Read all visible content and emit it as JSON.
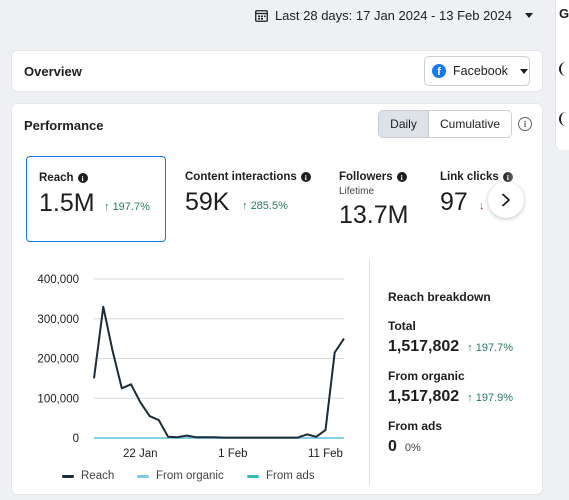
{
  "date_range": {
    "label": "Last 28 days: 17 Jan 2024 - 13 Feb 2024",
    "icon": "calendar-icon"
  },
  "right_panel": {
    "glyph": "G"
  },
  "overview": {
    "title": "Overview",
    "platform_select": "Facebook",
    "platform_color": "#1877f2"
  },
  "performance": {
    "title": "Performance",
    "view_toggle": [
      "Daily",
      "Cumulative"
    ],
    "selected_view": "Daily",
    "metrics": [
      {
        "label": "Reach",
        "value": "1.5M",
        "change": "197.7%",
        "selected": true
      },
      {
        "label": "Content interactions",
        "value": "59K",
        "change": "285.5%"
      },
      {
        "label": "Followers",
        "sublabel": "Lifetime",
        "value": "13.7M"
      },
      {
        "label": "Link clicks",
        "value": "97"
      }
    ]
  },
  "chart_data": {
    "type": "line",
    "x": [
      "17 Jan",
      "18 Jan",
      "19 Jan",
      "20 Jan",
      "21 Jan",
      "22 Jan",
      "23 Jan",
      "24 Jan",
      "25 Jan",
      "26 Jan",
      "27 Jan",
      "28 Jan",
      "29 Jan",
      "30 Jan",
      "31 Jan",
      "1 Feb",
      "2 Feb",
      "3 Feb",
      "4 Feb",
      "5 Feb",
      "6 Feb",
      "7 Feb",
      "8 Feb",
      "9 Feb",
      "10 Feb",
      "11 Feb",
      "12 Feb",
      "13 Feb"
    ],
    "x_ticks": [
      "22 Jan",
      "1 Feb",
      "11 Feb"
    ],
    "y_ticks": [
      "400,000",
      "300,000",
      "200,000",
      "100,000",
      "0"
    ],
    "ylim": [
      0,
      400000
    ],
    "series": [
      {
        "name": "Reach",
        "color": "#1c2b36",
        "values": [
          150000,
          330000,
          220000,
          125000,
          135000,
          90000,
          55000,
          45000,
          3000,
          2000,
          6000,
          2000,
          2000,
          2000,
          1000,
          1000,
          1000,
          1000,
          1000,
          1000,
          1000,
          1000,
          1000,
          9000,
          3000,
          20000,
          215000,
          250000
        ]
      },
      {
        "name": "From organic",
        "color": "#7ec9e8",
        "values": [
          0,
          0,
          0,
          0,
          0,
          0,
          0,
          0,
          0,
          0,
          0,
          0,
          0,
          0,
          0,
          0,
          0,
          0,
          0,
          0,
          0,
          0,
          0,
          0,
          0,
          0,
          0,
          0
        ]
      },
      {
        "name": "From ads",
        "color": "#2cc3b4",
        "values": [
          0,
          0,
          0,
          0,
          0,
          0,
          0,
          0,
          0,
          0,
          0,
          0,
          0,
          0,
          0,
          0,
          0,
          0,
          0,
          0,
          0,
          0,
          0,
          0,
          0,
          0,
          0,
          0
        ]
      }
    ]
  },
  "breakdown": {
    "title": "Reach breakdown",
    "items": [
      {
        "label": "Total",
        "value": "1,517,802",
        "change": "197.7%"
      },
      {
        "label": "From organic",
        "value": "1,517,802",
        "change": "197.9%"
      },
      {
        "label": "From ads",
        "value": "0",
        "change": "0%"
      }
    ]
  }
}
